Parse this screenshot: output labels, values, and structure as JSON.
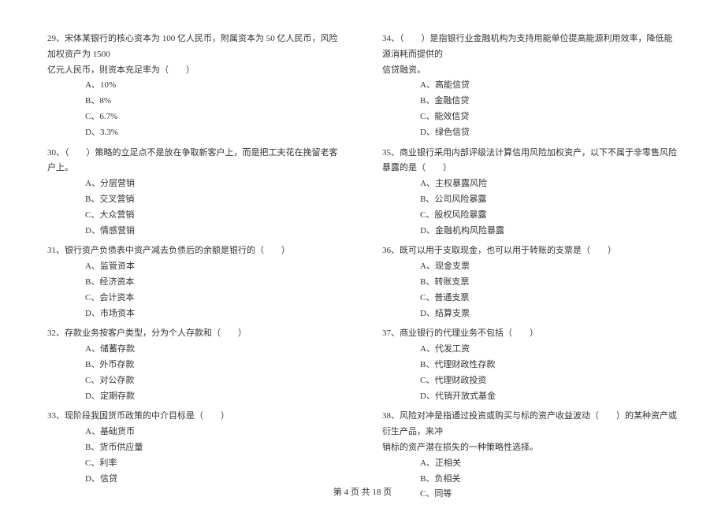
{
  "left_column": {
    "q29": {
      "text_line1": "29、宋体某银行的核心资本为 100 亿人民币，附属资本为 50 亿人民币，风险加权资产为 1500",
      "text_line2": "亿元人民币，则资本充足率为（　　）",
      "a": "A、10%",
      "b": "B、8%",
      "c": "C、6.7%",
      "d": "D、3.3%"
    },
    "q30": {
      "text": "30、（　　）策略的立足点不是放在争取新客户上，而是把工夫花在挽留老客户上。",
      "a": "A、分层营销",
      "b": "B、交叉营销",
      "c": "C、大众营销",
      "d": "D、情感营销"
    },
    "q31": {
      "text": "31、银行资产负债表中资产减去负债后的余额是银行的（　　）",
      "a": "A、监管资本",
      "b": "B、经济资本",
      "c": "C、会计资本",
      "d": "D、市场资本"
    },
    "q32": {
      "text": "32、存款业务按客户类型，分为个人存款和（　　）",
      "a": "A、储蓄存款",
      "b": "B、外币存款",
      "c": "C、对公存款",
      "d": "D、定期存款"
    },
    "q33": {
      "text": "33、现阶段我国货币政策的中介目标是（　　）",
      "a": "A、基础货币",
      "b": "B、货币供应量",
      "c": "C、利率",
      "d": "D、信贷"
    }
  },
  "right_column": {
    "q34": {
      "text_line1": "34、（　　）是指银行业金融机构为支持用能单位提高能源利用效率，降低能源消耗而提供的",
      "text_line2": "信贷融资。",
      "a": "A、高能信贷",
      "b": "B、金融信贷",
      "c": "C、能效信贷",
      "d": "D、绿色信贷"
    },
    "q35": {
      "text": "35、商业银行采用内部评级法计算信用风险加权资产，以下不属于非零售风险暴露的是（　　）",
      "a": "A、主权暴露风险",
      "b": "B、公司风险暴露",
      "c": "C、股权风险暴露",
      "d": "D、金融机构风险暴露"
    },
    "q36": {
      "text": "36、既可以用于支取现金，也可以用于转账的支票是（　　）",
      "a": "A、现金支票",
      "b": "B、转账支票",
      "c": "C、普通支票",
      "d": "D、结算支票"
    },
    "q37": {
      "text": "37、商业银行的代理业务不包括（　　）",
      "a": "A、代发工资",
      "b": "B、代理财政性存款",
      "c": "C、代理财政投资",
      "d": "D、代销开放式基金"
    },
    "q38": {
      "text_line1": "38、风险对冲是指通过投资或购买与标的资产收益波动（　　）的某种资产或衍生产品，来冲",
      "text_line2": "销标的资产潜在损失的一种策略性选择。",
      "a": "A、正相关",
      "b": "B、负相关",
      "c": "C、同等"
    }
  },
  "footer": "第 4 页 共 18 页"
}
